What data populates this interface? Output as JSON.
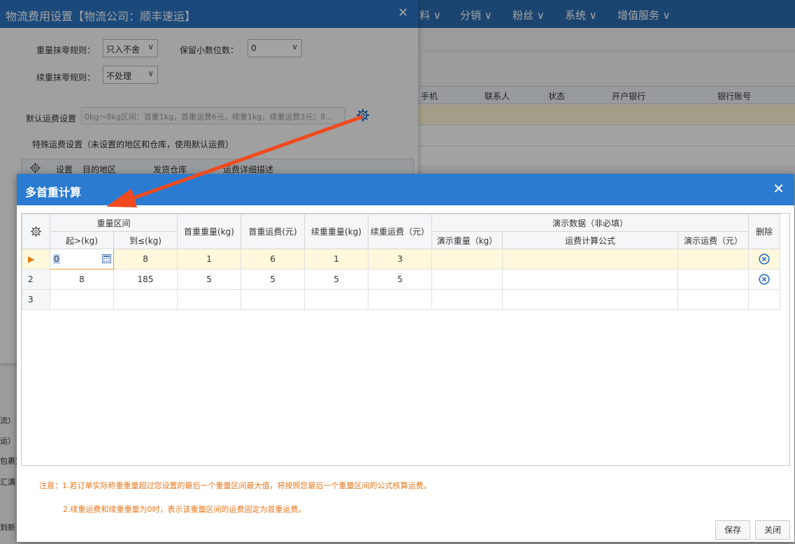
{
  "background_app": {
    "nav_items": [
      "料 ∨",
      "分销 ∨",
      "粉丝 ∨",
      "系统 ∨",
      "增值服务 ∨"
    ],
    "grid_headers": [
      "手机",
      "联系人",
      "状态",
      "开户银行",
      "银行账号"
    ],
    "left_fragments": [
      "流）",
      "运）",
      "包裹）",
      "汇满",
      "到新"
    ]
  },
  "dialog_logistics": {
    "title": "物流费用设置【物流公司：顺丰速运】",
    "close_glyph": "✕",
    "weight_rounding_label": "重量抹零规则：",
    "weight_rounding_value": "只入不舍",
    "decimal_label": "保留小数位数：",
    "decimal_value": "0",
    "extra_rounding_label": "续重抹零规则：",
    "extra_rounding_value": "不处理",
    "default_fee_label": "默认运费设置",
    "default_fee_value": "0kg～8kg区间：首重1kg，首重运费6元，续重1kg，续重运费3元；8...",
    "special_fee_label": "特殊运费设置（未设置的地区和仓库，使用默认运费）",
    "special_grid_headers": [
      "设置",
      "目的地区",
      "发货仓库",
      "运费详细描述"
    ]
  },
  "dialog_multi": {
    "title": "多首重计算",
    "close_glyph": "✕",
    "group_weight_range": "重量区间",
    "group_demo": "演示数据（非必填）",
    "headers": {
      "start": "起>(kg)",
      "end": "到≤(kg)",
      "first_weight": "首重重量(kg)",
      "first_fee": "首重运费(元)",
      "extra_weight": "续重重量(kg)",
      "extra_fee": "续重运费（元）",
      "demo_weight": "演示重量（kg）",
      "formula": "运费计算公式",
      "demo_fee": "演示运费（元）",
      "delete": "删除"
    },
    "rows": [
      {
        "no": "▶",
        "start": "0",
        "end": "8",
        "first_weight": "1",
        "first_fee": "6",
        "extra_weight": "1",
        "extra_fee": "3"
      },
      {
        "no": "2",
        "start": "8",
        "end": "185",
        "first_weight": "5",
        "first_fee": "5",
        "extra_weight": "5",
        "extra_fee": "5"
      },
      {
        "no": "3",
        "start": "",
        "end": "",
        "first_weight": "",
        "first_fee": "",
        "extra_weight": "",
        "extra_fee": ""
      }
    ],
    "note_line1": "注意：1.若订单实际称重重量超过您设置的最后一个重量区间最大值，将按照您最后一个重量区间的公式核算运费。",
    "note_line2": "2.续重运费和续重重量为0时，表示该重量区间的运费固定为首重运费。",
    "save_label": "保存",
    "close_label": "关闭"
  },
  "colors": {
    "title_bar": "#2a7bd1",
    "active_row": "#fff8dc",
    "note_text": "#e8761a",
    "arrow": "#f04a1e"
  }
}
